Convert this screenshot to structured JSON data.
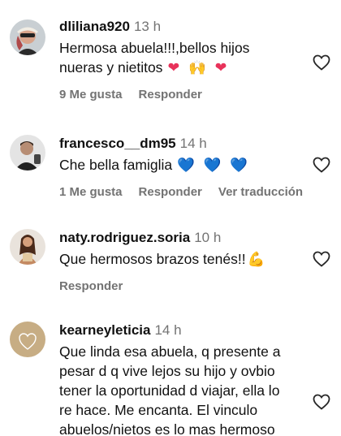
{
  "comments": [
    {
      "username": "dliliana920",
      "time": "13 h",
      "text_lines": [
        "Hermosa abuela!!!,bellos hijos",
        "nueras y nietitos"
      ],
      "emoji": "❤ 🙌 ❤",
      "likes": "9 Me gusta",
      "reply": "Responder"
    },
    {
      "username": "francesco__dm95",
      "time": "14 h",
      "text_lines": [
        "Che bella famiglia"
      ],
      "emoji": "💙 💙 💙",
      "likes": "1 Me gusta",
      "reply": "Responder",
      "translate": "Ver traducción"
    },
    {
      "username": "naty.rodriguez.soria",
      "time": "10 h",
      "text_lines": [
        "Que hermosos brazos tenés!!"
      ],
      "emoji": "💪",
      "reply": "Responder"
    },
    {
      "username": "kearneyleticia",
      "time": "14 h",
      "text_lines": [
        "Que linda esa abuela, q presente a",
        "pesar d q vive lejos su hijo y ovbio",
        "tener la oportunidad d viajar, ella lo",
        "re hace. Me encanta. El vinculo",
        "abuelos/nietos es lo mas hermoso"
      ]
    }
  ],
  "icons": {
    "like": "heart-outline-icon"
  }
}
